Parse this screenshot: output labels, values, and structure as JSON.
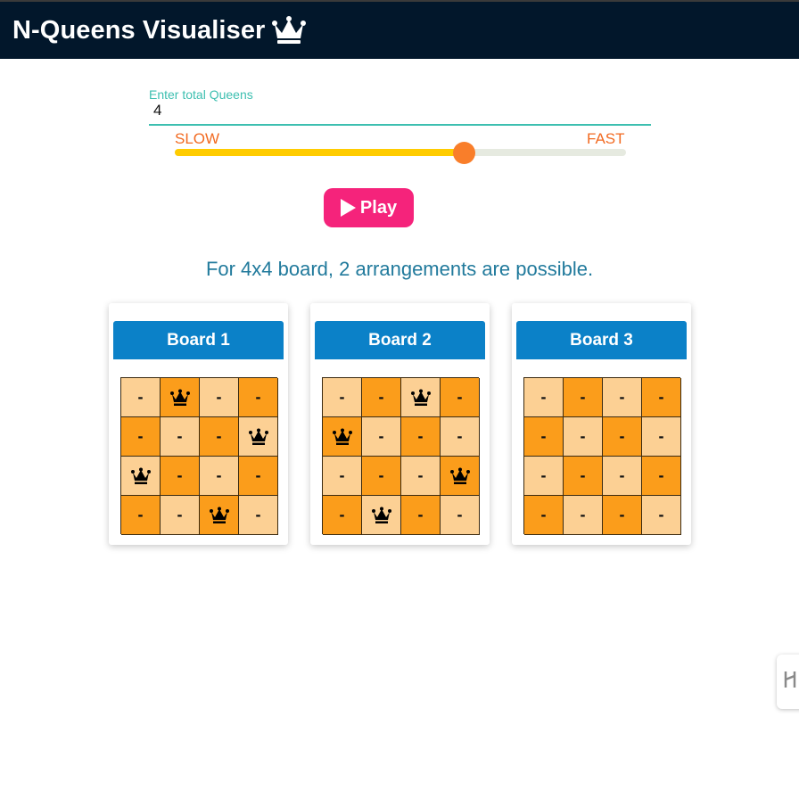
{
  "app": {
    "title": "N-Queens Visualiser",
    "crown_icon": "crown-icon"
  },
  "controls": {
    "queens_input": {
      "label": "Enter total Queens",
      "value": "4"
    },
    "speed": {
      "slow_label": "SLOW",
      "fast_label": "FAST",
      "level": 0.64
    },
    "play_button": {
      "label": "Play",
      "icon": "play-icon"
    }
  },
  "result": {
    "text": "For 4x4 board, 2 arrangements are possible."
  },
  "boards": [
    {
      "title": "Board 1",
      "cells": [
        [
          "-",
          "Q",
          "-",
          "-"
        ],
        [
          "-",
          "-",
          "-",
          "Q"
        ],
        [
          "Q",
          "-",
          "-",
          "-"
        ],
        [
          "-",
          "-",
          "Q",
          "-"
        ]
      ]
    },
    {
      "title": "Board 2",
      "cells": [
        [
          "-",
          "-",
          "Q",
          "-"
        ],
        [
          "Q",
          "-",
          "-",
          "-"
        ],
        [
          "-",
          "-",
          "-",
          "Q"
        ],
        [
          "-",
          "Q",
          "-",
          "-"
        ]
      ]
    },
    {
      "title": "Board 3",
      "cells": [
        [
          "-",
          "-",
          "-",
          "-"
        ],
        [
          "-",
          "-",
          "-",
          "-"
        ],
        [
          "-",
          "-",
          "-",
          "-"
        ],
        [
          "-",
          "-",
          "-",
          "-"
        ]
      ]
    }
  ],
  "colors": {
    "appbar": "#02172b",
    "accent_teal": "#3dbfb0",
    "slider_fill": "#ffcc00",
    "slider_thumb": "#f97e2a",
    "play_button": "#f5237b",
    "board_header": "#0b81c8",
    "cell_light": "#fcd094",
    "cell_dark": "#fb9d1b"
  },
  "side_widget": {
    "icon": "handle-icon"
  }
}
